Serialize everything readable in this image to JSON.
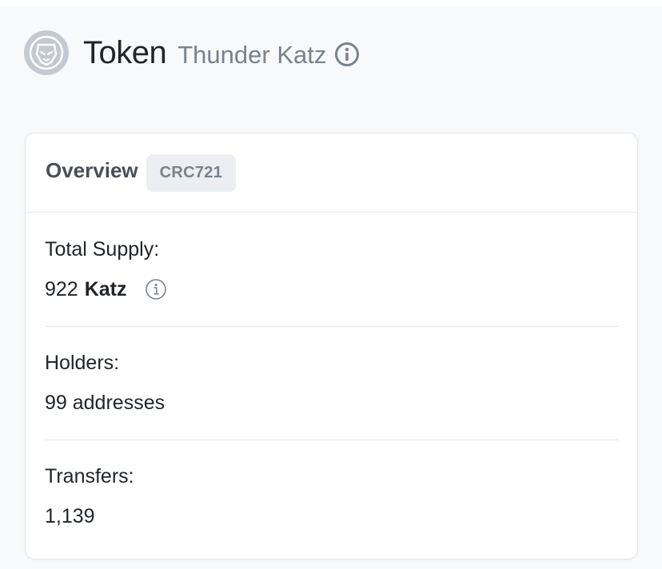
{
  "header": {
    "title": "Token",
    "token_name": "Thunder Katz",
    "logo_icon": "lion-logo-icon",
    "info_icon": "info-circle-icon"
  },
  "overview": {
    "title": "Overview",
    "badge": "CRC721",
    "total_supply": {
      "label": "Total Supply:",
      "amount": "922",
      "unit": "Katz",
      "info_icon": "info-circle-icon"
    },
    "holders": {
      "label": "Holders:",
      "value": "99 addresses"
    },
    "transfers": {
      "label": "Transfers:",
      "value": "1,139"
    }
  },
  "colors": {
    "page_background": "#f8f9fa",
    "muted_text": "#77838f",
    "badge_background": "#eceef1",
    "border": "#e3e6ea"
  }
}
